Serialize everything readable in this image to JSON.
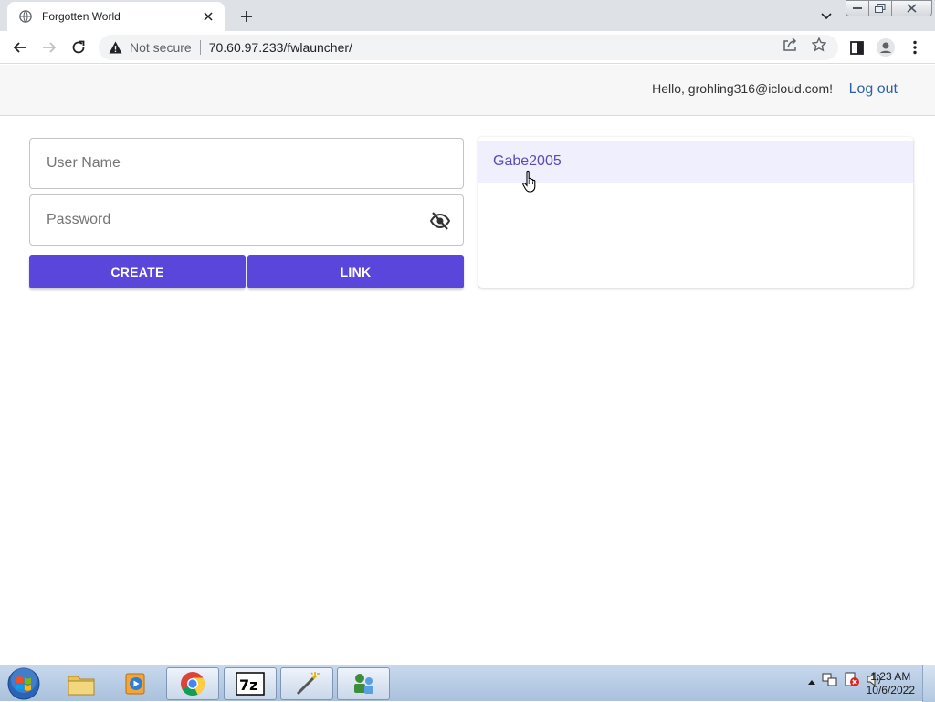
{
  "browser": {
    "tab_title": "Forgotten World",
    "security_label": "Not secure",
    "url": "70.60.97.233/fwlauncher/"
  },
  "header": {
    "greeting": "Hello, grohling316@icloud.com!",
    "logout_label": "Log out"
  },
  "form": {
    "username_placeholder": "User Name",
    "password_placeholder": "Password",
    "create_label": "CREATE",
    "link_label": "LINK"
  },
  "accounts": {
    "items": [
      {
        "label": "Gabe2005"
      }
    ]
  },
  "taskbar": {
    "time": "1:23 AM",
    "date": "10/6/2022",
    "apps": [
      "file-explorer",
      "media-player",
      "chrome",
      "7-zip",
      "wand-tool",
      "network-app"
    ]
  },
  "colors": {
    "accent": "#5a46db",
    "list_highlight": "#efeffd",
    "link": "#2e62a8"
  },
  "icons": [
    "globe-icon",
    "close-icon",
    "plus-icon",
    "chevron-down-icon",
    "back-icon",
    "forward-icon",
    "reload-icon",
    "warning-icon",
    "share-icon",
    "star-icon",
    "sidepanel-icon",
    "profile-icon",
    "menu-icon",
    "eye-off-icon",
    "hand-cursor-icon",
    "windows-start-icon"
  ]
}
